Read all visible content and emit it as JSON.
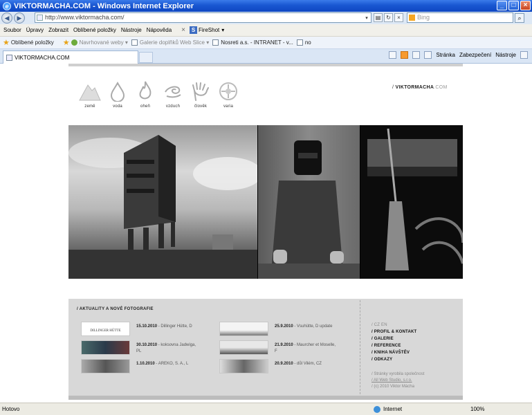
{
  "window": {
    "title": "VIKTORMACHA.COM - Windows Internet Explorer",
    "icon": "ie-icon"
  },
  "address": {
    "url": "http://www.viktormacha.com/",
    "search_placeholder": "Bing"
  },
  "menu": {
    "items": [
      "Soubor",
      "Úpravy",
      "Zobrazit",
      "Oblíbené položky",
      "Nástroje",
      "Nápověda"
    ],
    "fireshot": "FireShot"
  },
  "favorites": {
    "label": "Oblíbené položky",
    "items": [
      "Navrhované weby",
      "Galerie doplňků Web Slice",
      "Nosreti a.s. - INTRANET - v...",
      "no"
    ]
  },
  "tab": {
    "title": "VIKTORMACHA.COM",
    "tools": [
      "Stránka",
      "Zabezpečení",
      "Nástroje"
    ]
  },
  "site": {
    "nav": [
      "země",
      "voda",
      "oheň",
      "vzduch",
      "člověk",
      "varia"
    ],
    "brand_prefix": "/ ",
    "brand_name": "VIKTORMACHA",
    "brand_domain": ".COM",
    "news_heading": "/ AKTUALITY A NOVÉ FOTOGRAFIE",
    "news": [
      {
        "date": "15.10.2010",
        "text": "- Dillinger Hütte, D",
        "thumb_text": "DILLINGER HÜTTE"
      },
      {
        "date": "30.10.2010",
        "text": "- koksovna Jadwiga, PL",
        "thumb_text": ""
      },
      {
        "date": "1.10.2010",
        "text": "- AREKO, S. A., L",
        "thumb_text": ""
      },
      {
        "date": "25.9.2010",
        "text": "- Vsuhütte, D update",
        "thumb_text": ""
      },
      {
        "date": "21.9.2010",
        "text": "- Maurcher et Moselle, F",
        "thumb_text": ""
      },
      {
        "date": "20.9.2010",
        "text": "- důl Vilém, CZ",
        "thumb_text": ""
      }
    ],
    "lang": "/ CZ EN",
    "links": [
      "PROFIL & KONTAKT",
      "GALERIE",
      "REFERENCE",
      "KNIHA NÁVŠTĚV",
      "ODKAZY"
    ],
    "footer": [
      "/ Stránky vyrobila společnost",
      "/ All Web Studio, s.r.o.",
      "/ (c) 2010 Viktor Mácha"
    ]
  },
  "status": {
    "text": "Hotovo",
    "zone": "Internet",
    "zoom": "100%"
  }
}
